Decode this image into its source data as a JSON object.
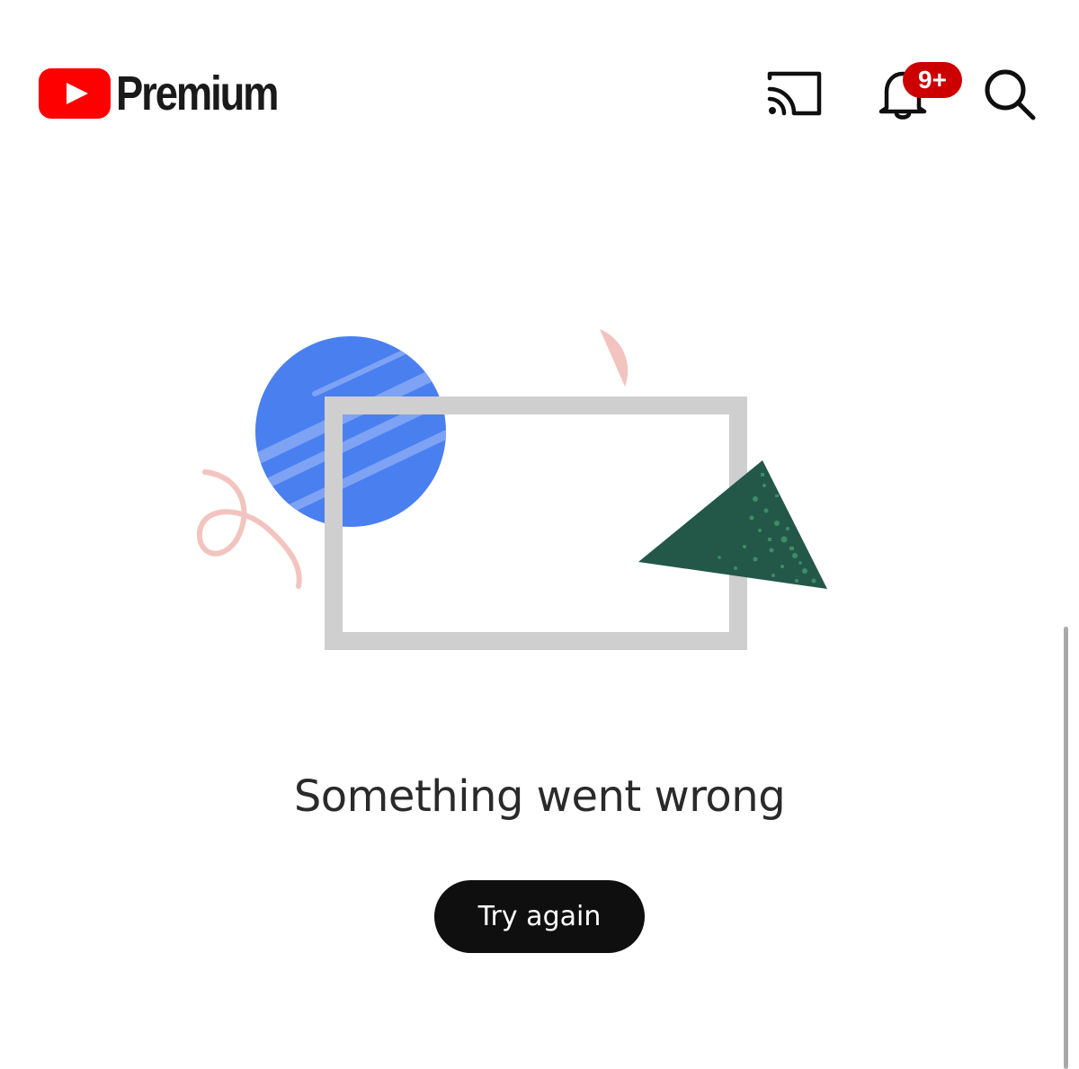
{
  "header": {
    "logo_text": "Premium",
    "logo_icon": "youtube-play-icon",
    "notifications_badge": "9+",
    "icons": [
      "cast-icon",
      "notifications-bell-icon",
      "search-icon"
    ]
  },
  "illustration": {
    "shapes": [
      "blue-circle",
      "pink-semicircle",
      "gray-rectangle-frame",
      "green-triangle",
      "pink-squiggle"
    ]
  },
  "error": {
    "message": "Something went wrong",
    "retry_label": "Try again"
  },
  "colors": {
    "brand_red": "#ff0000",
    "badge_red": "#cc0000",
    "button_bg": "#0f0f0f",
    "circle_blue": "#4a7ff0",
    "triangle_green": "#235848",
    "frame_gray": "#cfcfcf",
    "accent_pink": "#f2c2bd"
  }
}
